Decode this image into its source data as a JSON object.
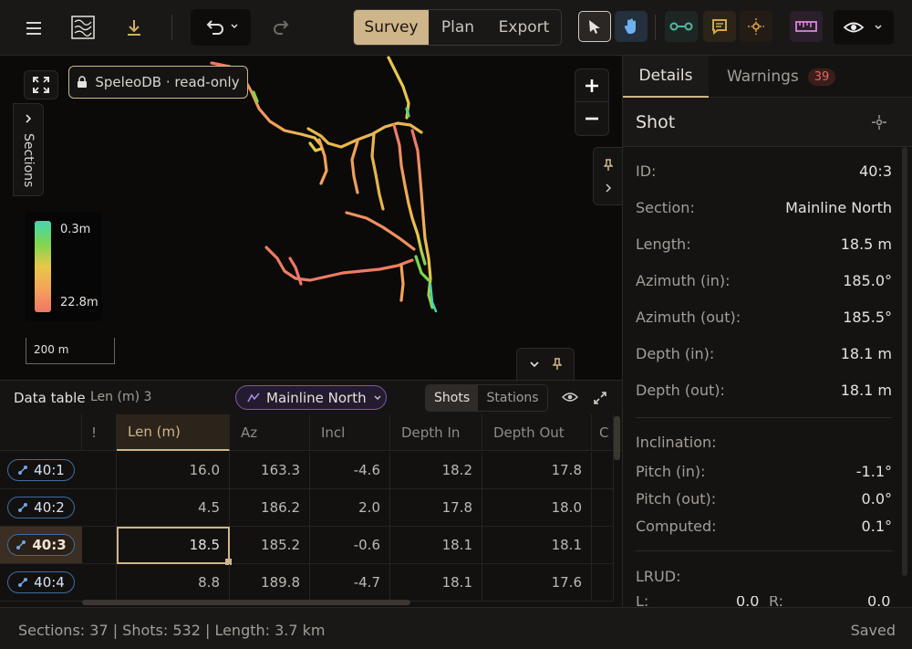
{
  "toolbar": {
    "mode_tabs": [
      "Survey",
      "Plan",
      "Export"
    ],
    "active_mode": "Survey"
  },
  "map": {
    "badge_label": "SpeleoDB · read-only",
    "sections_label": "Sections",
    "legend_top": "0.3m",
    "legend_bottom": "22.8m",
    "scale_label": "200 m",
    "depth_gradient": [
      "#43d6b4",
      "#7fd54f",
      "#e7c84a",
      "#f4a25a",
      "#f07566"
    ]
  },
  "right_panel": {
    "tabs": {
      "details": "Details",
      "warnings": "Warnings",
      "warnings_count": "39"
    },
    "heading": "Shot",
    "fields": [
      {
        "label": "ID:",
        "value": "40:3"
      },
      {
        "label": "Section:",
        "value": "Mainline North"
      },
      {
        "label": "Length:",
        "value": "18.5 m"
      },
      {
        "label": "Azimuth (in):",
        "value": "185.0°"
      },
      {
        "label": "Azimuth (out):",
        "value": "185.5°"
      },
      {
        "label": "Depth (in):",
        "value": "18.1 m"
      },
      {
        "label": "Depth (out):",
        "value": "18.1 m"
      }
    ],
    "inclination_heading": "Inclination:",
    "inclination_fields": [
      {
        "label": "Pitch (in):",
        "value": "-1.1°"
      },
      {
        "label": "Pitch (out):",
        "value": "0.0°"
      },
      {
        "label": "Computed:",
        "value": "0.1°"
      }
    ],
    "lrud_heading": "LRUD:",
    "lrud_partial": [
      {
        "label": "L:",
        "value": "0.0"
      },
      {
        "label": "R:",
        "value": "0.0"
      }
    ]
  },
  "data_table": {
    "title": "Data table",
    "column_hint": "Len (m) 3",
    "section_filter": "Mainline North",
    "view_toggle": [
      "Shots",
      "Stations"
    ],
    "active_view": "Shots",
    "columns": [
      "!",
      "Len (m)",
      "Az",
      "Incl",
      "Depth In",
      "Depth Out",
      "C"
    ],
    "rows": [
      {
        "id": "40:1",
        "cells": [
          "16.0",
          "163.3",
          "-4.6",
          "18.2",
          "17.8"
        ]
      },
      {
        "id": "40:2",
        "cells": [
          "4.5",
          "186.2",
          "2.0",
          "17.8",
          "18.0"
        ]
      },
      {
        "id": "40:3",
        "cells": [
          "18.5",
          "185.2",
          "-0.6",
          "18.1",
          "18.1"
        ]
      },
      {
        "id": "40:4",
        "cells": [
          "8.8",
          "189.8",
          "-4.7",
          "18.1",
          "17.6"
        ]
      }
    ],
    "selected_row": "40:3"
  },
  "status": {
    "summary": "Sections: 37 | Shots: 532 | Length: 3.7 km",
    "save_state": "Saved"
  },
  "colors": {
    "accent": "#cfb58a",
    "warning_badge": "#e0665c",
    "station_tag": "#3f6ea0"
  }
}
